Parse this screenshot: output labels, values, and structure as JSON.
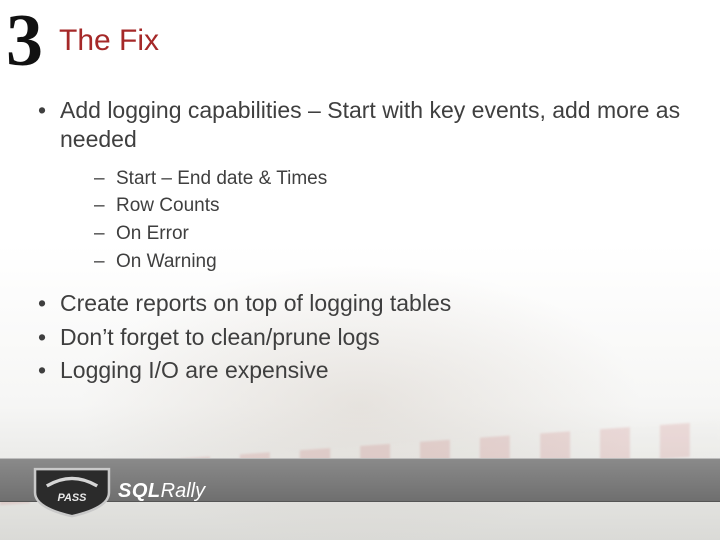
{
  "header": {
    "number": "3",
    "title": "The Fix"
  },
  "bullets": {
    "b1": "Add logging capabilities – Start with key events, add more as needed",
    "sub": {
      "s1": "Start – End date & Times",
      "s2": "Row Counts",
      "s3": "On Error",
      "s4": "On Warning"
    },
    "b2": "Create reports on top of logging tables",
    "b3": "Don’t forget to clean/prune logs",
    "b4": "Logging I/O are expensive"
  },
  "footer": {
    "logo_pass": "PASS",
    "logo_sql": "SQL",
    "logo_rally": "Rally"
  }
}
